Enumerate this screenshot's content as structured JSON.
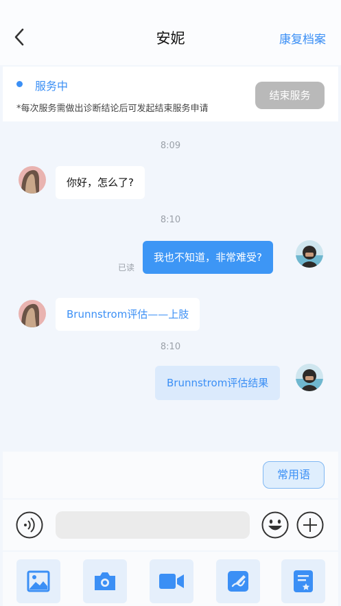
{
  "header": {
    "title": "安妮",
    "back_icon": "chevron-left-icon",
    "record_link": "康复档案"
  },
  "service": {
    "status": "服务中",
    "note": "*每次服务需做出诊断结论后可发起结束服务申请",
    "end_button": "结束服务"
  },
  "messages": [
    {
      "time": "8:09",
      "side": "left",
      "text": "你好，怎么了?"
    },
    {
      "time": "8:10",
      "side": "right",
      "text": "我也不知道，非常难受?",
      "status": "已读"
    },
    {
      "side": "left",
      "text": "Brunnstrom评估——上肢"
    },
    {
      "time": "8:10",
      "side": "right",
      "text": "Brunnstrom评估结果"
    }
  ],
  "phrases": {
    "button": "常用语"
  },
  "input": {
    "placeholder": "",
    "voice_icon": "voice-icon",
    "emoji_icon": "emoji-icon",
    "plus_icon": "plus-icon"
  },
  "tools": [
    {
      "icon": "image-icon"
    },
    {
      "icon": "camera-icon"
    },
    {
      "icon": "video-icon"
    },
    {
      "icon": "edit-icon"
    },
    {
      "icon": "form-icon"
    }
  ],
  "colors": {
    "accent": "#3b8ff5",
    "outgoing_bubble": "#3d96f5",
    "end_button": "#b9b9b9",
    "background": "#f2f6fc"
  }
}
